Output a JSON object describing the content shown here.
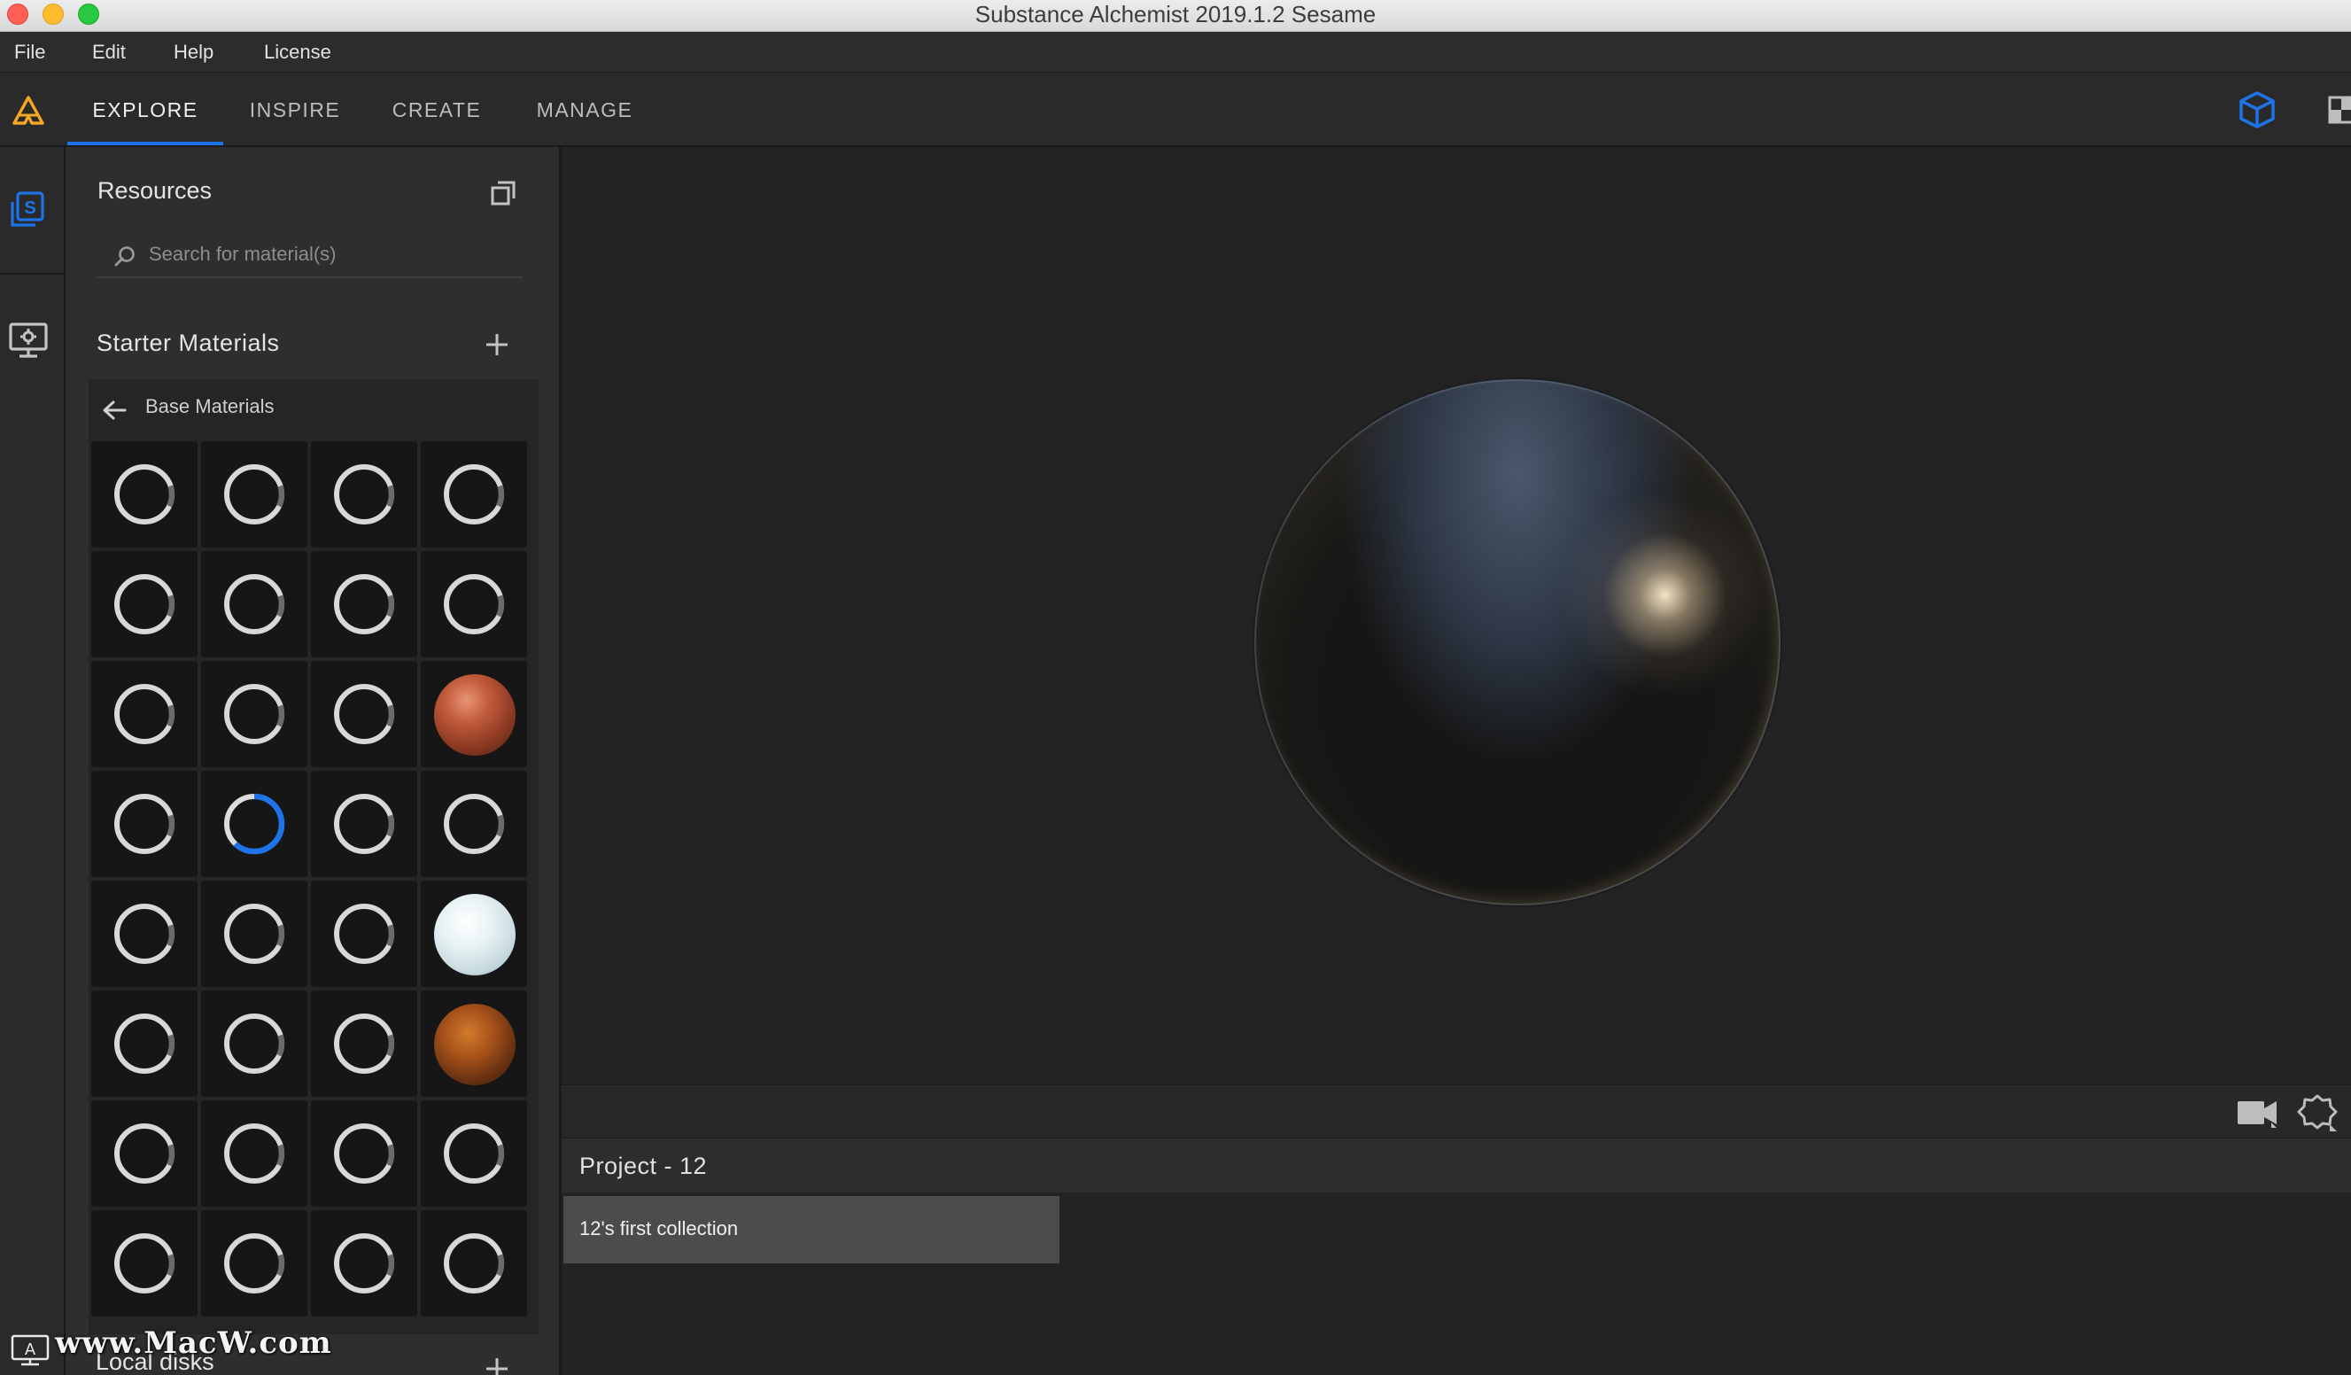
{
  "window": {
    "title": "Substance Alchemist 2019.1.2 Sesame"
  },
  "menubar": {
    "items": [
      "File",
      "Edit",
      "Help",
      "License"
    ]
  },
  "nav": {
    "tabs": [
      "EXPLORE",
      "INSPIRE",
      "CREATE",
      "MANAGE"
    ],
    "active_tab": "EXPLORE"
  },
  "colors": {
    "accent": "#1e73e8",
    "logo": "#f5a623",
    "panel_bg": "#2e2e2e",
    "viewport_bg": "#232323"
  },
  "icons": {
    "rail": [
      "library-icon",
      "display-settings-icon"
    ],
    "header_right": [
      "cube-view-icon",
      "layout-toggle-icon"
    ],
    "viewport_toolbar": [
      "camera-icon",
      "environment-icon"
    ]
  },
  "resources": {
    "title": "Resources",
    "search_placeholder": "Search for material(s)",
    "section_title": "Starter Materials",
    "breadcrumb": "Base Materials",
    "grid": {
      "columns": 4,
      "tiles": [
        "loading",
        "loading",
        "loading",
        "loading",
        "loading",
        "loading",
        "loading",
        "loading",
        "loading",
        "loading",
        "loading",
        "copper",
        "loading",
        "loading-active",
        "loading",
        "loading",
        "loading",
        "loading",
        "loading",
        "snow",
        "loading",
        "loading",
        "loading",
        "rust",
        "loading",
        "loading",
        "loading",
        "loading",
        "loading",
        "loading",
        "loading",
        "loading"
      ]
    },
    "next_section_title": "Local disks"
  },
  "project": {
    "title": "Project - 12",
    "collections": [
      "12's first collection"
    ]
  },
  "watermark": {
    "text": "www.MacW.com"
  }
}
